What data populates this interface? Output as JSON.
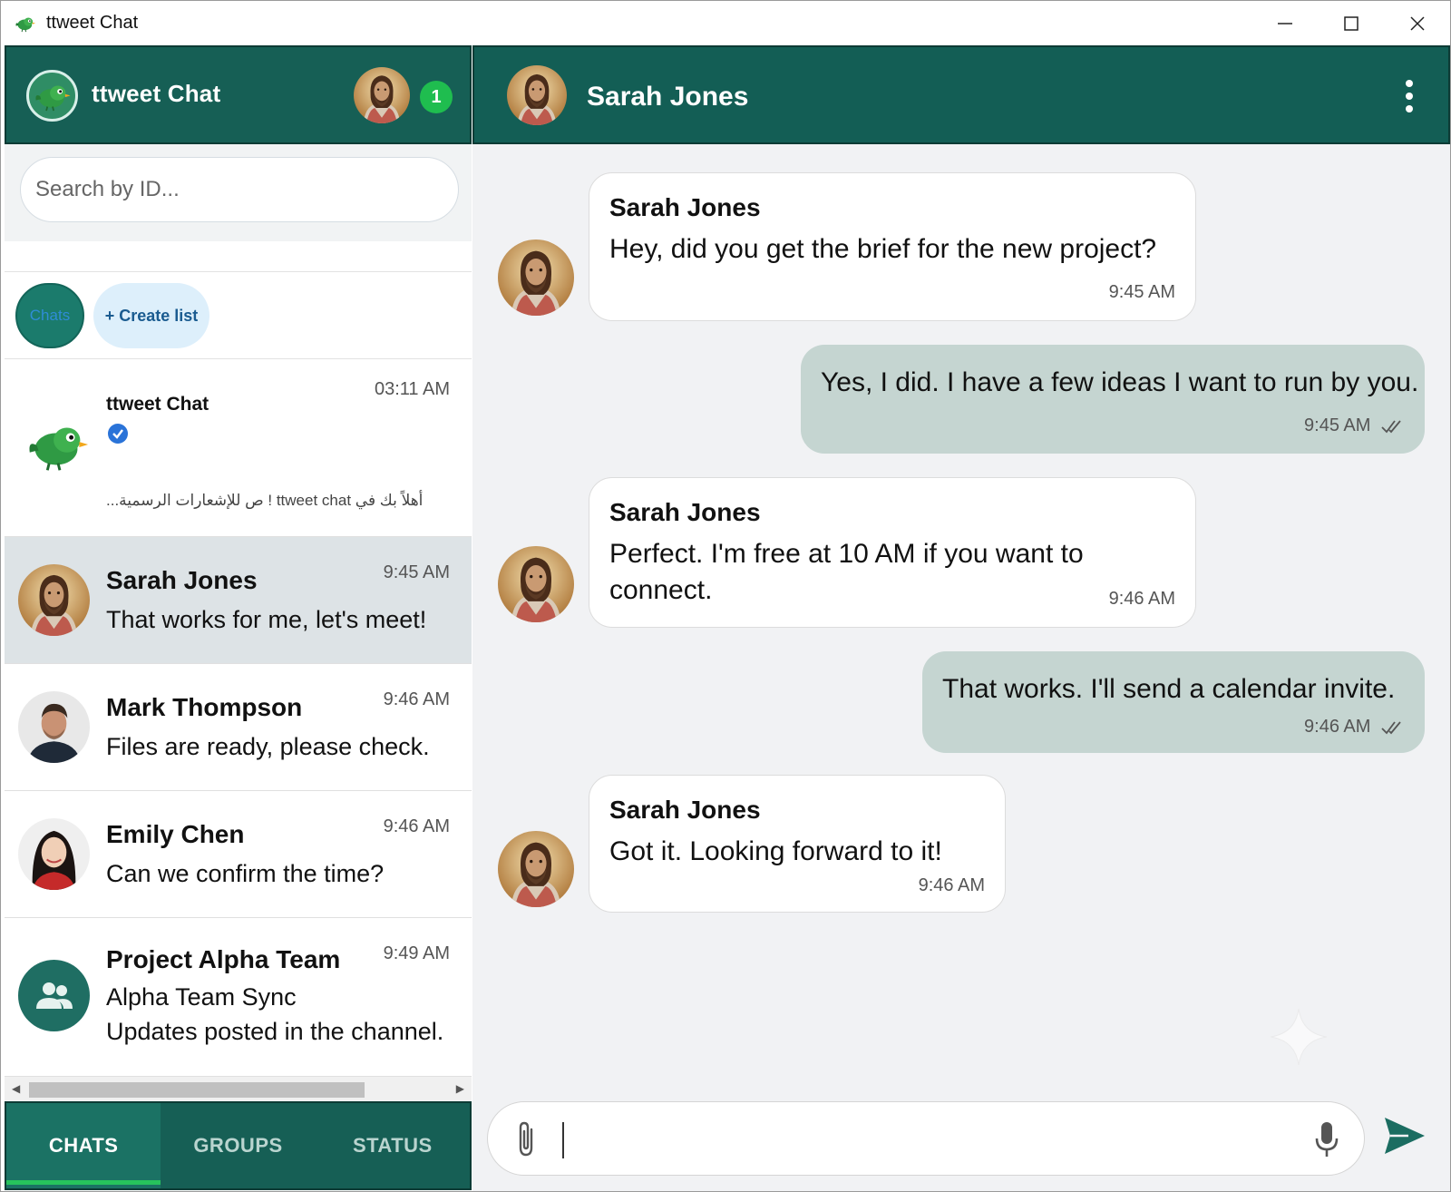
{
  "window": {
    "title": "ttweet Chat"
  },
  "sidebar": {
    "brand": "ttweet Chat",
    "notification_count": "1",
    "search_placeholder": "Search by ID...",
    "filters": {
      "chats": "Chats",
      "create_list": "+ Create list"
    },
    "chats": [
      {
        "name": "ttweet Chat",
        "time": "03:11 AM",
        "preview": "أهلاً بك في ttweet chat ! ص للإشعارات الرسمية...",
        "verified": true
      },
      {
        "name": "Sarah Jones",
        "time": "9:45 AM",
        "preview": "That works for me, let's meet!"
      },
      {
        "name": "Mark Thompson",
        "time": "9:46 AM",
        "preview": "Files are ready, please check."
      },
      {
        "name": "Emily Chen",
        "time": "9:46 AM",
        "preview": "Can we confirm the time?"
      },
      {
        "name": "Project Alpha Team",
        "time": "9:49 AM",
        "preview_line1": "Alpha Team Sync",
        "preview_line2": "Updates posted in the channel."
      }
    ],
    "tabs": [
      "CHATS",
      "GROUPS",
      "STATUS"
    ]
  },
  "conversation": {
    "contact_name": "Sarah Jones",
    "messages": [
      {
        "direction": "in",
        "sender": "Sarah Jones",
        "text": "Hey, did you get the brief for the new project?",
        "time": "9:45 AM"
      },
      {
        "direction": "out",
        "text": "Yes, I did. I have a few ideas I want to run by you.",
        "time": "9:45 AM"
      },
      {
        "direction": "in",
        "sender": "Sarah Jones",
        "text_line1": "Perfect. I'm free at 10 AM if you want to",
        "text_line2": "connect.",
        "time": "9:46 AM"
      },
      {
        "direction": "out",
        "text": "That works. I'll send a calendar invite.",
        "time": "9:46 AM"
      },
      {
        "direction": "in",
        "sender": "Sarah Jones",
        "text": "Got it. Looking forward to it!",
        "time": "9:46 AM"
      }
    ],
    "composer_value": ""
  },
  "colors": {
    "header": "#165f55",
    "accent_green": "#1fbd4f",
    "outgoing_bubble": "#c5d5d1",
    "selected_row": "#dde3e6"
  },
  "icons": [
    "bird-logo-icon",
    "verified-icon",
    "group-icon",
    "kebab-menu-icon",
    "paperclip-icon",
    "microphone-icon",
    "send-icon",
    "minimize-icon",
    "maximize-icon",
    "close-icon",
    "double-check-icon"
  ]
}
